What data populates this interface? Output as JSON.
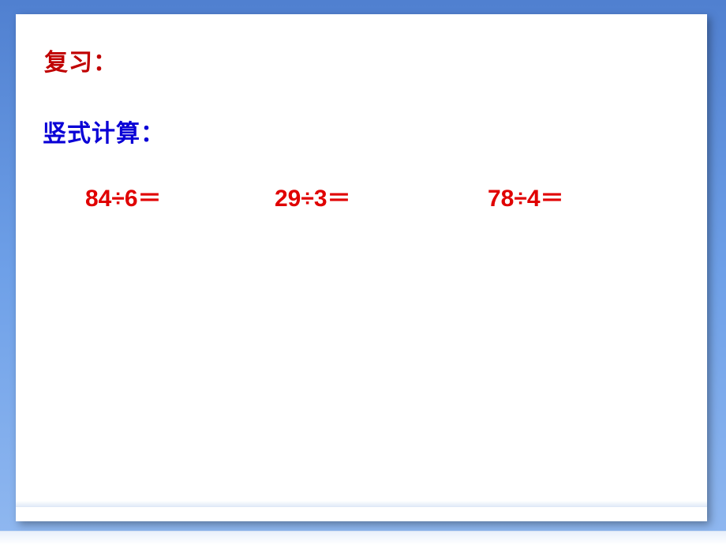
{
  "slide": {
    "title": "复习：",
    "subtitle": "竖式计算：",
    "equations": {
      "eq1": "84÷6＝",
      "eq2": "29÷3＝",
      "eq3": "78÷4＝"
    }
  }
}
